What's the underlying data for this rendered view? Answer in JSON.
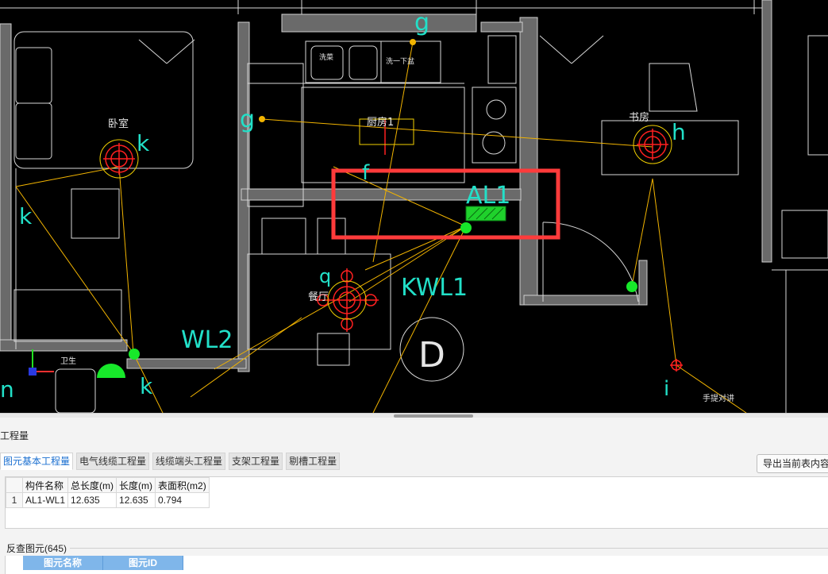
{
  "cad": {
    "room_labels": {
      "bedroom": "卧室",
      "kitchen": "厨房1",
      "study": "书房",
      "dining": "餐厅",
      "tv_area": "手提对讲",
      "sink_label": "洗菜",
      "sink_label2": "洗一下盆",
      "bath_label": "卫生"
    },
    "circuit_labels": {
      "al1": "AL1",
      "kwl1": "KWL1",
      "wl2": "WL2",
      "g1": "g",
      "g2": "g",
      "k1": "k",
      "k2": "k",
      "k3": "k",
      "h1": "h",
      "q1": "q",
      "f1": "f",
      "i1": "i",
      "n1": "n",
      "d1": "D"
    },
    "colors": {
      "wall": "#a8a8a8",
      "furniture": "#e6e6e6",
      "wire": "#f2b400",
      "fixture": "#ff2020",
      "annotation": "#22e0c8",
      "highlight": "#ff3b3b",
      "panel_fill": "#1fd12c",
      "node": "#17e82a"
    }
  },
  "panel": {
    "title": "工程量",
    "tabs": [
      "图元基本工程量",
      "电气线缆工程量",
      "线缆端头工程量",
      "支架工程量",
      "剔槽工程量"
    ],
    "active_tab": 0,
    "export_button": "导出当前表内容",
    "table": {
      "headers": [
        "构件名称",
        "总长度(m)",
        "长度(m)",
        "表面积(m2)"
      ],
      "rows": [
        {
          "index": "1",
          "name": "AL1-WL1",
          "total_length": "12.635",
          "length": "12.635",
          "area": "0.794"
        }
      ]
    },
    "reverse": {
      "title": "反查图元(645)",
      "headers": [
        "图元名称",
        "图元ID"
      ]
    }
  }
}
